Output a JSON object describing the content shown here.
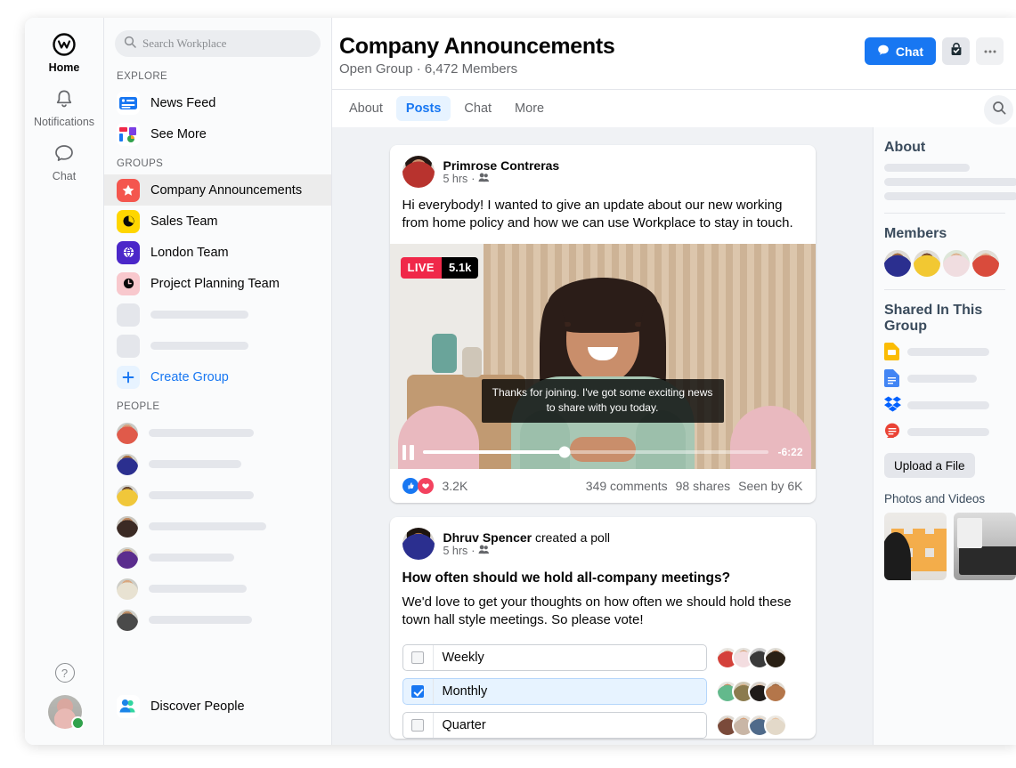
{
  "rail": {
    "items": [
      {
        "label": "Home",
        "icon": "workplace-home-icon",
        "active": true
      },
      {
        "label": "Notifications",
        "icon": "bell-icon",
        "active": false
      },
      {
        "label": "Chat",
        "icon": "chat-bubble-icon",
        "active": false
      }
    ],
    "help_icon": "help-question-icon",
    "avatar_icon": "user-avatar"
  },
  "sidebar": {
    "search": {
      "placeholder": "Search Workplace",
      "icon": "search-icon"
    },
    "explore_title": "EXPLORE",
    "explore": [
      {
        "label": "News Feed",
        "icon": "news-feed-icon"
      },
      {
        "label": "See More",
        "icon": "see-more-icon"
      }
    ],
    "groups_title": "GROUPS",
    "groups": [
      {
        "label": "Company Announcements",
        "icon": "star-icon",
        "color": "#f4564e",
        "selected": true
      },
      {
        "label": "Sales Team",
        "icon": "pie-chart-icon",
        "color": "#ffd600",
        "selected": false
      },
      {
        "label": "London Team",
        "icon": "globe-icon",
        "color": "#4b27c9",
        "selected": false
      },
      {
        "label": "Project Planning Team",
        "icon": "clock-icon",
        "color": "#f8c8cd",
        "selected": false
      }
    ],
    "create_group": {
      "label": "Create Group",
      "icon": "plus-icon"
    },
    "people_title": "PEOPLE",
    "discover_people": {
      "label": "Discover People",
      "icon": "people-icon"
    }
  },
  "header": {
    "title": "Company Announcements",
    "subtitle": "Open Group · 6,472 Members",
    "chat_button": {
      "label": "Chat",
      "icon": "chat-bubble-icon"
    },
    "joined_button": {
      "icon": "joined-check-icon"
    },
    "tabs": [
      {
        "label": "About",
        "active": false
      },
      {
        "label": "Posts",
        "active": true
      },
      {
        "label": "Chat",
        "active": false
      },
      {
        "label": "More",
        "active": false
      }
    ],
    "tab_search_icon": "search-icon"
  },
  "posts": [
    {
      "author": "Primrose Contreras",
      "author_suffix": "",
      "time": "5 hrs",
      "audience_icon": "members-group-icon",
      "text": "Hi everybody! I wanted to give an update about our new working from home policy and how we can use Workplace to stay in touch.",
      "video": {
        "live_label": "LIVE",
        "viewer_count": "5.1k",
        "caption": "Thanks for joining. I've got some exciting news to share with you today.",
        "time_remaining": "-6:22",
        "progress_percent": 41,
        "pause_icon": "pause-icon"
      },
      "reactions": {
        "count": "3.2K",
        "icons": [
          "like-icon",
          "love-icon"
        ]
      },
      "comments": "349 comments",
      "shares": "98 shares",
      "seen": "Seen by 6K"
    },
    {
      "author": "Dhruv Spencer",
      "author_suffix": " created a poll",
      "time": "5 hrs",
      "audience_icon": "members-group-icon",
      "question": "How often should we hold all-company meetings?",
      "text": "We'd love to get your thoughts on how often we should hold these town hall style meetings. So please vote!",
      "options": [
        {
          "label": "Weekly",
          "checked": false
        },
        {
          "label": "Monthly",
          "checked": true
        },
        {
          "label": "Quarter",
          "checked": false
        }
      ]
    }
  ],
  "rightbar": {
    "about_title": "About",
    "members_title": "Members",
    "shared_title": "Shared In This Group",
    "files": [
      {
        "icon": "google-slides-icon",
        "color": "#fbbc04"
      },
      {
        "icon": "google-docs-icon",
        "color": "#4285f4"
      },
      {
        "icon": "dropbox-icon",
        "color": "#0061ff"
      },
      {
        "icon": "red-file-icon",
        "color": "#ea4335"
      }
    ],
    "upload_button": "Upload a File",
    "photos_title": "Photos and Videos"
  },
  "colors": {
    "accent": "#1877f2",
    "live": "#f02849",
    "online": "#31a24c",
    "tab_active_bg": "#e7f3ff"
  }
}
